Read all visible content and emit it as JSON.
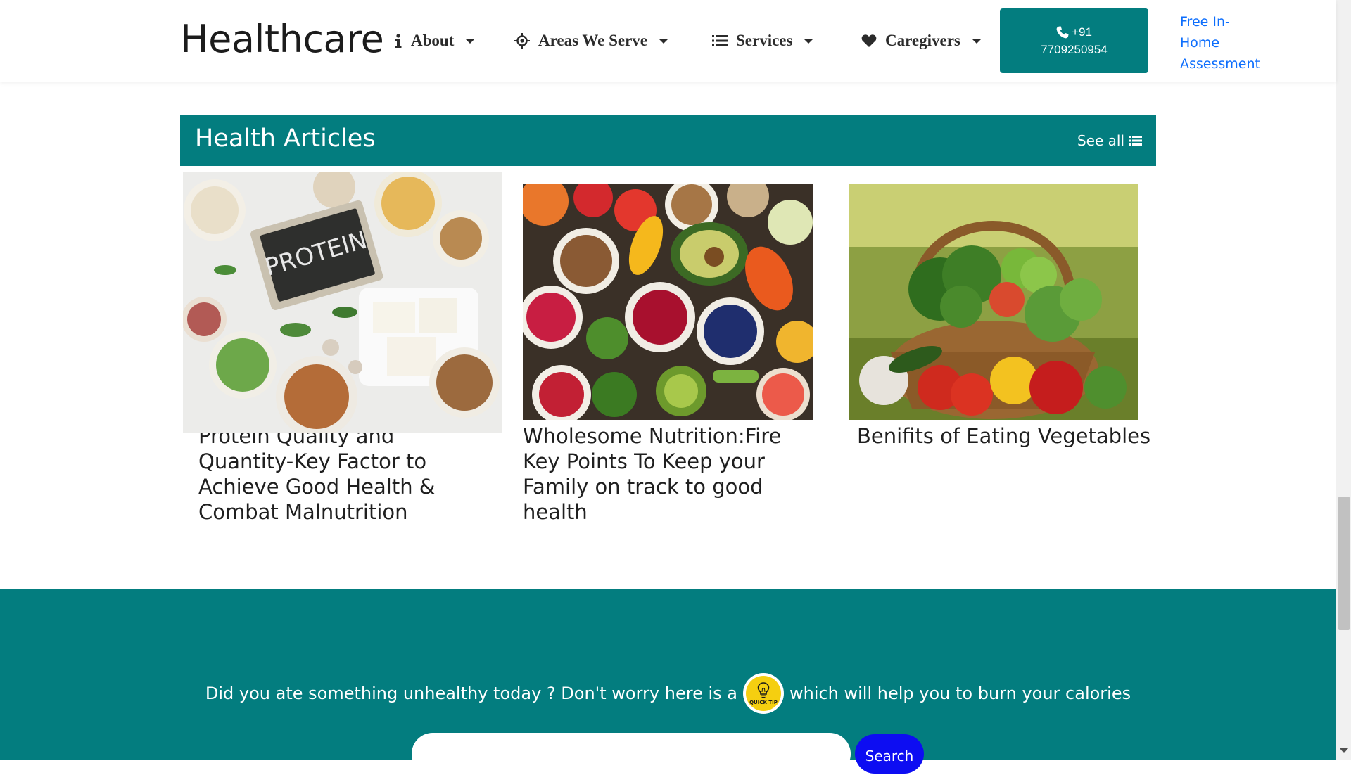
{
  "header": {
    "brand": "Healthcare",
    "nav": [
      {
        "label": "About",
        "icon": "info-icon"
      },
      {
        "label": "Areas We Serve",
        "icon": "crosshair-icon"
      },
      {
        "label": "Services",
        "icon": "list-icon"
      },
      {
        "label": "Caregivers",
        "icon": "heart-icon"
      }
    ],
    "phone": {
      "line1": "+91",
      "line2": "7709250954",
      "icon": "phone-icon"
    },
    "assessment": "Free In-Home Assessment"
  },
  "articles": {
    "title": "Health Articles",
    "see_all": "See all",
    "items": [
      {
        "title": "Protein Quality and Quantity-Key Factor to Achieve Good Health & Combat Malnutrition",
        "image": "protein-foods-photo"
      },
      {
        "title": "Wholesome Nutrition:Fire Key Points To Keep your Family on track to good health",
        "image": "fruits-vegetables-bowls-photo"
      },
      {
        "title": "Benifits of Eating Vegetables",
        "image": "vegetable-basket-photo"
      }
    ]
  },
  "quick_tip": {
    "text_before": "Did you ate something unhealthy today ? Don't worry here is a",
    "badge": "QUICK TIP",
    "text_after": "which will help you to burn your calories",
    "search_placeholder": "",
    "search_button": "Search"
  },
  "colors": {
    "teal": "#037d7f",
    "link": "#0d6efd",
    "search_button": "#0d0df2",
    "tip_badge": "#f5cf10"
  }
}
